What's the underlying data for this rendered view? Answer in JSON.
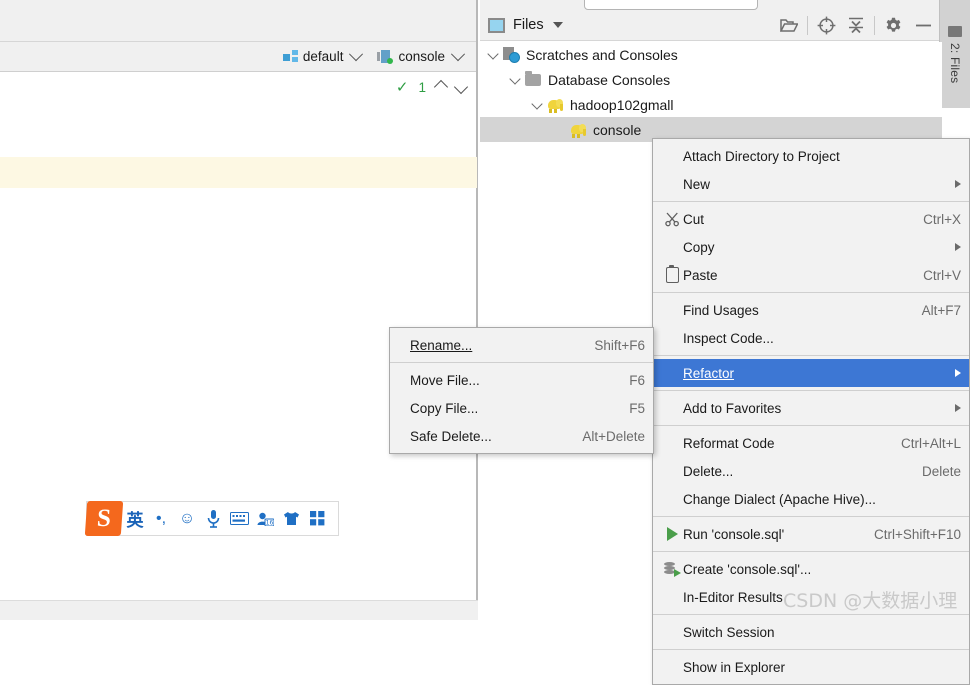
{
  "editor": {
    "run_config": {
      "label": "default",
      "icon": "module-icon"
    },
    "session": {
      "label": "console",
      "icon": "session-icon"
    },
    "inspections": {
      "icon": "inspection-check-icon",
      "count": "1",
      "prev": "⌃",
      "next": "⌄"
    }
  },
  "ime": {
    "logo": "S",
    "items": [
      {
        "name": "lang-mode",
        "glyph": "英"
      },
      {
        "name": "punctuation-mode",
        "glyph": "•,"
      },
      {
        "name": "emoji-panel",
        "glyph": "☺"
      },
      {
        "name": "voice-input",
        "glyph": "⬤"
      },
      {
        "name": "soft-keyboard",
        "glyph": "⌨"
      },
      {
        "name": "user-center",
        "glyph": "▣"
      },
      {
        "name": "skin-center",
        "glyph": "⬟"
      },
      {
        "name": "toolbox",
        "glyph": "▦"
      }
    ]
  },
  "files_panel": {
    "title": "Files",
    "title_icon": "files-window-icon",
    "dropdown_icon": "chevron-down-icon",
    "tools": [
      {
        "name": "open-folder-icon",
        "glyph": "🗁"
      },
      {
        "name": "scroll-from-source-icon",
        "glyph": "⊕"
      },
      {
        "name": "collapse-all-icon",
        "glyph": "⤓"
      },
      {
        "name": "settings-gear-icon",
        "glyph": "⚙"
      },
      {
        "name": "hide-window-icon",
        "glyph": "−"
      }
    ],
    "strip_tab": {
      "label": "2: Files",
      "icon": "folder-icon"
    },
    "tree": [
      {
        "label": "Scratches and Consoles",
        "icon": "scratches-icon",
        "depth": 0,
        "expanded": true,
        "selected": false
      },
      {
        "label": "Database Consoles",
        "icon": "folder-icon",
        "depth": 1,
        "expanded": true,
        "selected": false
      },
      {
        "label": "hadoop102gmall",
        "icon": "hive-icon",
        "depth": 2,
        "expanded": true,
        "selected": false
      },
      {
        "label": "console",
        "icon": "hive-icon",
        "depth": 3,
        "expanded": false,
        "selected": true
      }
    ]
  },
  "context_menu": {
    "items": [
      {
        "label": "Attach Directory to Project",
        "accel": "",
        "icon": "",
        "arrow": false,
        "highlighted": false,
        "sep_after": false
      },
      {
        "label": "New",
        "accel": "",
        "icon": "",
        "arrow": true,
        "highlighted": false,
        "sep_after": true
      },
      {
        "label": "Cut",
        "accel": "Ctrl+X",
        "icon": "scissors-icon",
        "arrow": false,
        "highlighted": false,
        "sep_after": false
      },
      {
        "label": "Copy",
        "accel": "",
        "icon": "",
        "arrow": true,
        "highlighted": false,
        "sep_after": false
      },
      {
        "label": "Paste",
        "accel": "Ctrl+V",
        "icon": "clipboard-icon",
        "arrow": false,
        "highlighted": false,
        "sep_after": true
      },
      {
        "label": "Find Usages",
        "accel": "Alt+F7",
        "icon": "",
        "arrow": false,
        "highlighted": false,
        "sep_after": false
      },
      {
        "label": "Inspect Code...",
        "accel": "",
        "icon": "",
        "arrow": false,
        "highlighted": false,
        "sep_after": true
      },
      {
        "label": "Refactor",
        "accel": "",
        "icon": "",
        "arrow": true,
        "highlighted": true,
        "sep_after": true
      },
      {
        "label": "Add to Favorites",
        "accel": "",
        "icon": "",
        "arrow": true,
        "highlighted": false,
        "sep_after": true
      },
      {
        "label": "Reformat Code",
        "accel": "Ctrl+Alt+L",
        "icon": "",
        "arrow": false,
        "highlighted": false,
        "sep_after": false
      },
      {
        "label": "Delete...",
        "accel": "Delete",
        "icon": "",
        "arrow": false,
        "highlighted": false,
        "sep_after": false
      },
      {
        "label": "Change Dialect (Apache Hive)...",
        "accel": "",
        "icon": "",
        "arrow": false,
        "highlighted": false,
        "sep_after": true
      },
      {
        "label": "Run 'console.sql'",
        "accel": "Ctrl+Shift+F10",
        "icon": "play-icon",
        "arrow": false,
        "highlighted": false,
        "sep_after": true
      },
      {
        "label": "Create 'console.sql'...",
        "accel": "",
        "icon": "database-run-icon",
        "arrow": false,
        "highlighted": false,
        "sep_after": false
      },
      {
        "label": "In-Editor Results",
        "accel": "",
        "icon": "",
        "arrow": false,
        "highlighted": false,
        "sep_after": true
      },
      {
        "label": "Switch Session",
        "accel": "",
        "icon": "",
        "arrow": false,
        "highlighted": false,
        "sep_after": true
      },
      {
        "label": "Show in Explorer",
        "accel": "",
        "icon": "",
        "arrow": false,
        "highlighted": false,
        "sep_after": false
      }
    ]
  },
  "refactor_submenu": {
    "items": [
      {
        "label": "Rename...",
        "accel": "Shift+F6",
        "sep_after": true
      },
      {
        "label": "Move File...",
        "accel": "F6",
        "sep_after": false
      },
      {
        "label": "Copy File...",
        "accel": "F5",
        "sep_after": false
      },
      {
        "label": "Safe Delete...",
        "accel": "Alt+Delete",
        "sep_after": false
      }
    ]
  },
  "watermark": {
    "text": "CSDN @大数据小理"
  },
  "colors": {
    "menu_bg": "#f2f2f2",
    "highlight": "#3d77d4",
    "selection": "#d4d4d4",
    "caret_line": "#fdf8e3",
    "toolbar_bg": "#f0f0f0"
  }
}
